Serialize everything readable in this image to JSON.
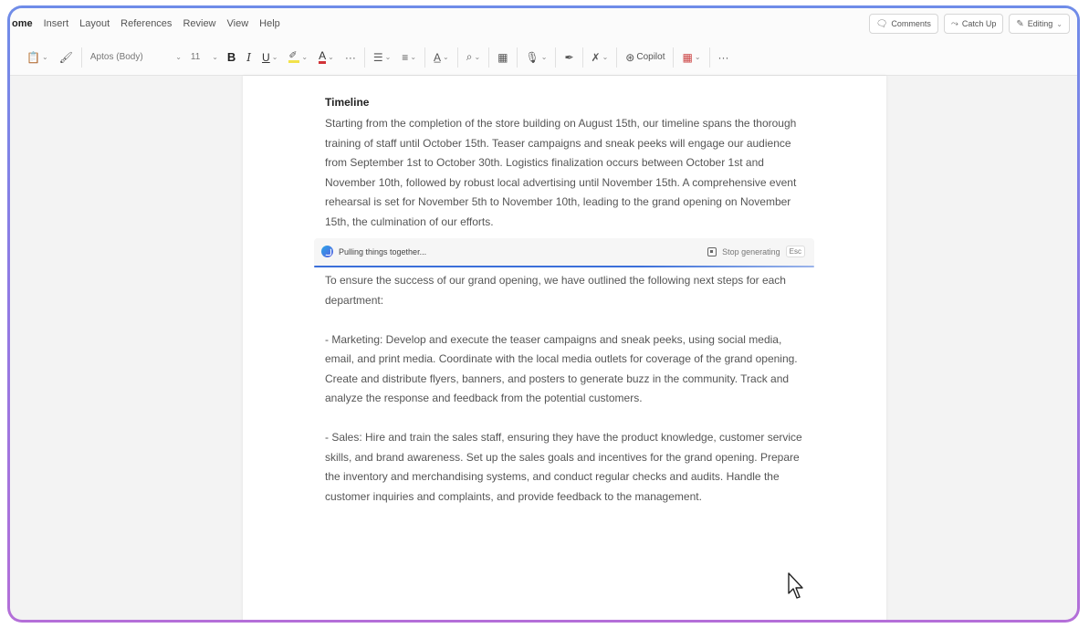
{
  "tabs": [
    "ome",
    "Insert",
    "Layout",
    "References",
    "Review",
    "View",
    "Help"
  ],
  "header_buttons": {
    "comments": "Comments",
    "catchup": "Catch Up",
    "editing": "Editing"
  },
  "ribbon": {
    "font_name": "Aptos (Body)",
    "font_size": "11",
    "bold": "B",
    "italic": "I",
    "underline": "U",
    "font_color": "A",
    "more": "···",
    "copilot": "Copilot",
    "overflow": "···"
  },
  "document": {
    "heading": "Timeline",
    "timeline_paragraph": "Starting from the completion of the store building on August 15th, our timeline spans the thorough training of staff until October 15th. Teaser campaigns and sneak peeks will engage our audience from September 1st to October 30th. Logistics finalization occurs between October 1st and November 10th, followed by robust local advertising until November 15th. A comprehensive event rehearsal is set for November 5th to November 10th, leading to the grand opening on November 15th, the culmination of our efforts.",
    "next_steps_intro": "To ensure the success of our grand opening, we have outlined the following next steps for each department:",
    "marketing": "- Marketing: Develop and execute the teaser campaigns and sneak peeks, using social media, email, and print media. Coordinate with the local media outlets for coverage of the grand opening. Create and distribute flyers, banners, and posters to generate buzz in the community. Track and analyze the response and feedback from the potential customers.",
    "sales": "- Sales: Hire and train the sales staff, ensuring they have the product knowledge, customer service skills, and brand awareness. Set up the sales goals and incentives for the grand opening. Prepare the inventory and merchandising systems, and conduct regular checks and audits. Handle the customer inquiries and complaints, and provide feedback to the management."
  },
  "generation": {
    "status": "Pulling things together...",
    "stop_label": "Stop generating",
    "esc": "Esc"
  }
}
